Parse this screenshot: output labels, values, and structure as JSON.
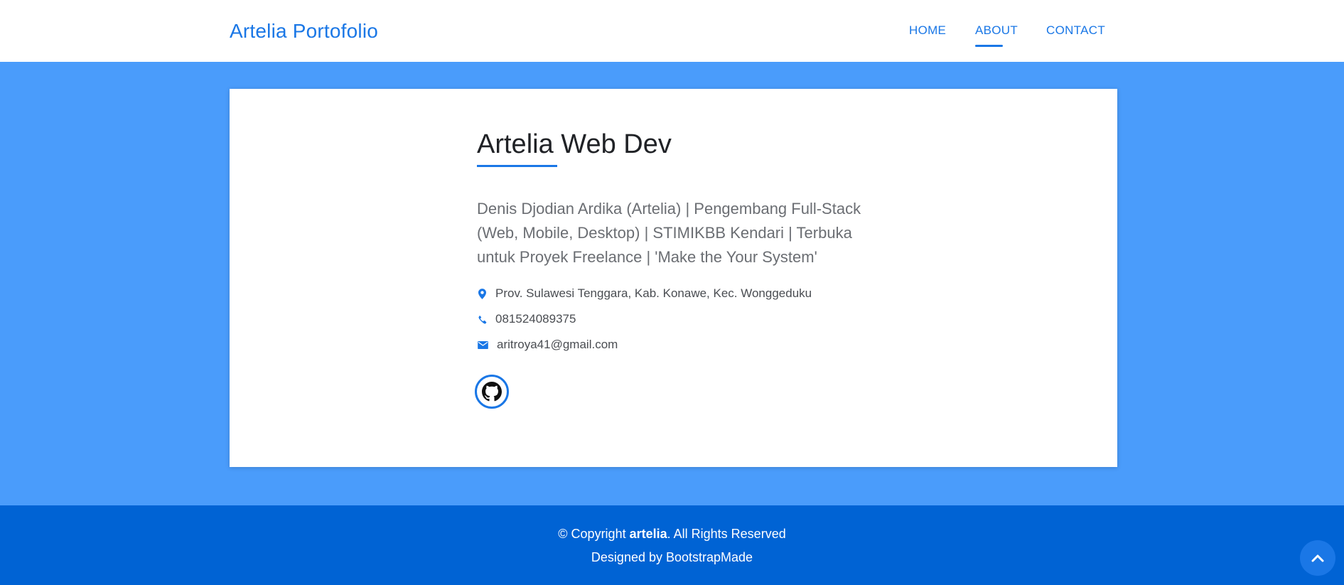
{
  "header": {
    "brand": "Artelia Portofolio",
    "nav": [
      {
        "label": "HOME"
      },
      {
        "label": "ABOUT",
        "active": true
      },
      {
        "label": "CONTACT"
      }
    ]
  },
  "about": {
    "title": "Artelia Web Dev",
    "description": "Denis Djodian Ardika (Artelia) | Pengembang Full-Stack (Web, Mobile, Desktop) | STIMIKBB Kendari | Terbuka untuk Proyek Freelance | 'Make the Your System'",
    "contacts": {
      "address": {
        "icon": "map-marker-icon",
        "text": "Prov. Sulawesi Tenggara, Kab. Konawe, Kec. Wonggeduku"
      },
      "phone": {
        "icon": "phone-icon",
        "text": "081524089375"
      },
      "email": {
        "icon": "envelope-icon",
        "text": "aritroya41@gmail.com"
      }
    },
    "social": [
      {
        "icon": "github-icon"
      }
    ]
  },
  "footer": {
    "copyright_prefix": "© Copyright ",
    "copyright_brand": "artelia",
    "copyright_suffix": ". All Rights Reserved",
    "designed_by_prefix": "Designed by ",
    "designed_by_link": "BootstrapMade"
  },
  "colors": {
    "accent": "#1a77e6",
    "page_background": "#4a9cfb",
    "footer_background": "#0063d4"
  }
}
